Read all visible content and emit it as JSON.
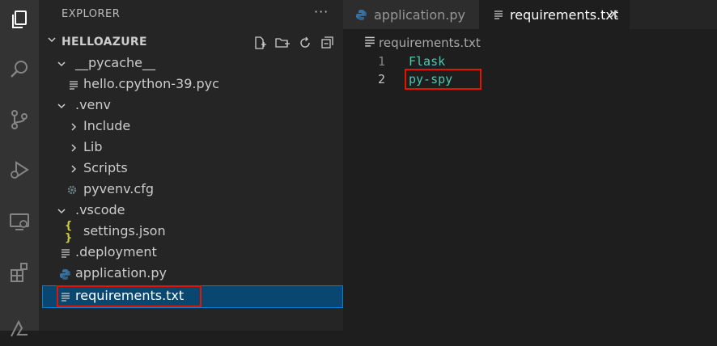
{
  "sidebar": {
    "header": "EXPLORER",
    "more": "···",
    "section_title": "HELLOAZURE",
    "tree": [
      {
        "label": "__pycache__"
      },
      {
        "label": "hello.cpython-39.pyc"
      },
      {
        "label": ".venv"
      },
      {
        "label": "Include"
      },
      {
        "label": "Lib"
      },
      {
        "label": "Scripts"
      },
      {
        "label": "pyvenv.cfg"
      },
      {
        "label": ".vscode"
      },
      {
        "label": "settings.json"
      },
      {
        "label": ".deployment"
      },
      {
        "label": "application.py"
      },
      {
        "label": "requirements.txt"
      }
    ]
  },
  "tabs": [
    {
      "label": "application.py"
    },
    {
      "label": "requirements.txt",
      "close": "✕"
    }
  ],
  "breadcrumb": {
    "label": "requirements.txt"
  },
  "editor": {
    "lines": [
      {
        "number": "1",
        "text": "Flask"
      },
      {
        "number": "2",
        "text": "py-spy"
      }
    ]
  },
  "colors": {
    "activity_bar": "#333333",
    "sidebar": "#252526",
    "editor": "#1e1e1e",
    "selection": "#094771",
    "highlight_box": "#e51400",
    "code_text": "#4ec9b0",
    "python_blue": "#3572a5",
    "json_yellow": "#cbcb41"
  }
}
